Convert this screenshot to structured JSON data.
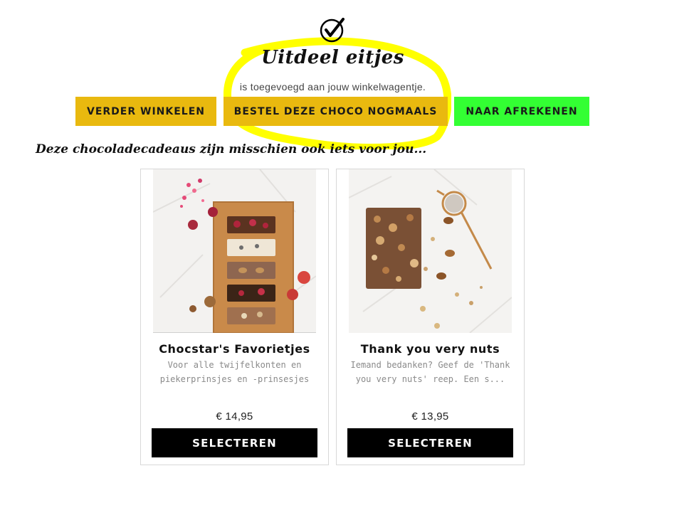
{
  "header": {
    "check_icon": "check-circle-icon",
    "product_name": "Uitdeel eitjes",
    "added_message": "is toegevoegd aan jouw winkelwagentje."
  },
  "actions": {
    "continue_label": "VERDER WINKELEN",
    "reorder_label": "BESTEL DEZE CHOCO NOGMAALS",
    "checkout_label": "NAAR AFREKENEN",
    "colors": {
      "continue": "#e9b90f",
      "reorder": "#e9b90f",
      "checkout": "#33ff33"
    }
  },
  "suggestions": {
    "heading": "Deze chocoladecadeaus zijn misschien ook iets voor jou...",
    "items": [
      {
        "name": "Chocstar's Favorietjes",
        "description": "Voor alle twijfelkonten en piekerprinsjes en -prinsesjes h...",
        "price": "€ 14,95",
        "button_label": "SELECTEREN"
      },
      {
        "name": "Thank you very nuts",
        "description": "Iemand bedanken? Geef de 'Thank you very nuts' reep. Een s...",
        "price": "€ 13,95",
        "button_label": "SELECTEREN"
      }
    ]
  },
  "annotation_color": "#ffff00"
}
